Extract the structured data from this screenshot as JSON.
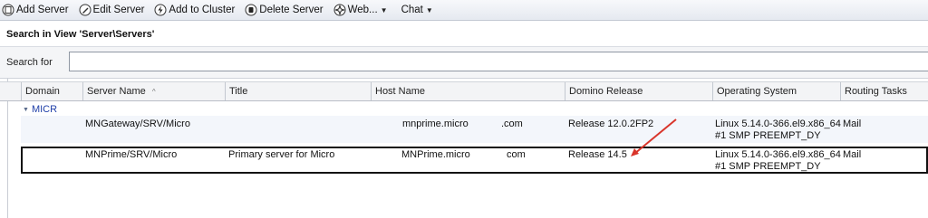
{
  "toolbar": {
    "buttons": [
      {
        "label": "Add Server",
        "icon": "add-server-icon"
      },
      {
        "label": "Edit Server",
        "icon": "edit-pencil-icon"
      },
      {
        "label": "Add to Cluster",
        "icon": "lightning-icon"
      },
      {
        "label": "Delete Server",
        "icon": "delete-server-icon"
      },
      {
        "label": "Web...",
        "icon": "web-gear-icon"
      },
      {
        "label": "Chat"
      }
    ]
  },
  "search": {
    "title": "Search in View 'Server\\Servers'",
    "label": "Search for",
    "value": ""
  },
  "columns": [
    "Domain",
    "Server Name",
    "Title",
    "Host Name",
    "Domino Release",
    "Operating System",
    "Routing Tasks"
  ],
  "category": "MICR",
  "rows": [
    {
      "server": "MNGateway/SRV/Micro",
      "title": "",
      "host_a": "mnprime.micro",
      "host_b": ".com",
      "release": "Release 12.0.2FP2",
      "os_line1": "Linux 5.14.0-366.el9.x86_64",
      "os_line2": "#1 SMP PREEMPT_DY",
      "routing": "Mail"
    },
    {
      "server": "MNPrime/SRV/Micro",
      "title": "Primary server for Micro",
      "host_a": "MNPrime.micro",
      "host_b": "com",
      "release": "Release 14.5",
      "os_line1": "Linux 5.14.0-366.el9.x86_64",
      "os_line2": "#1 SMP PREEMPT_DY",
      "routing": "Mail"
    }
  ],
  "colors": {
    "annotation_arrow": "#d9352b",
    "category_text": "#1f3fa8"
  }
}
